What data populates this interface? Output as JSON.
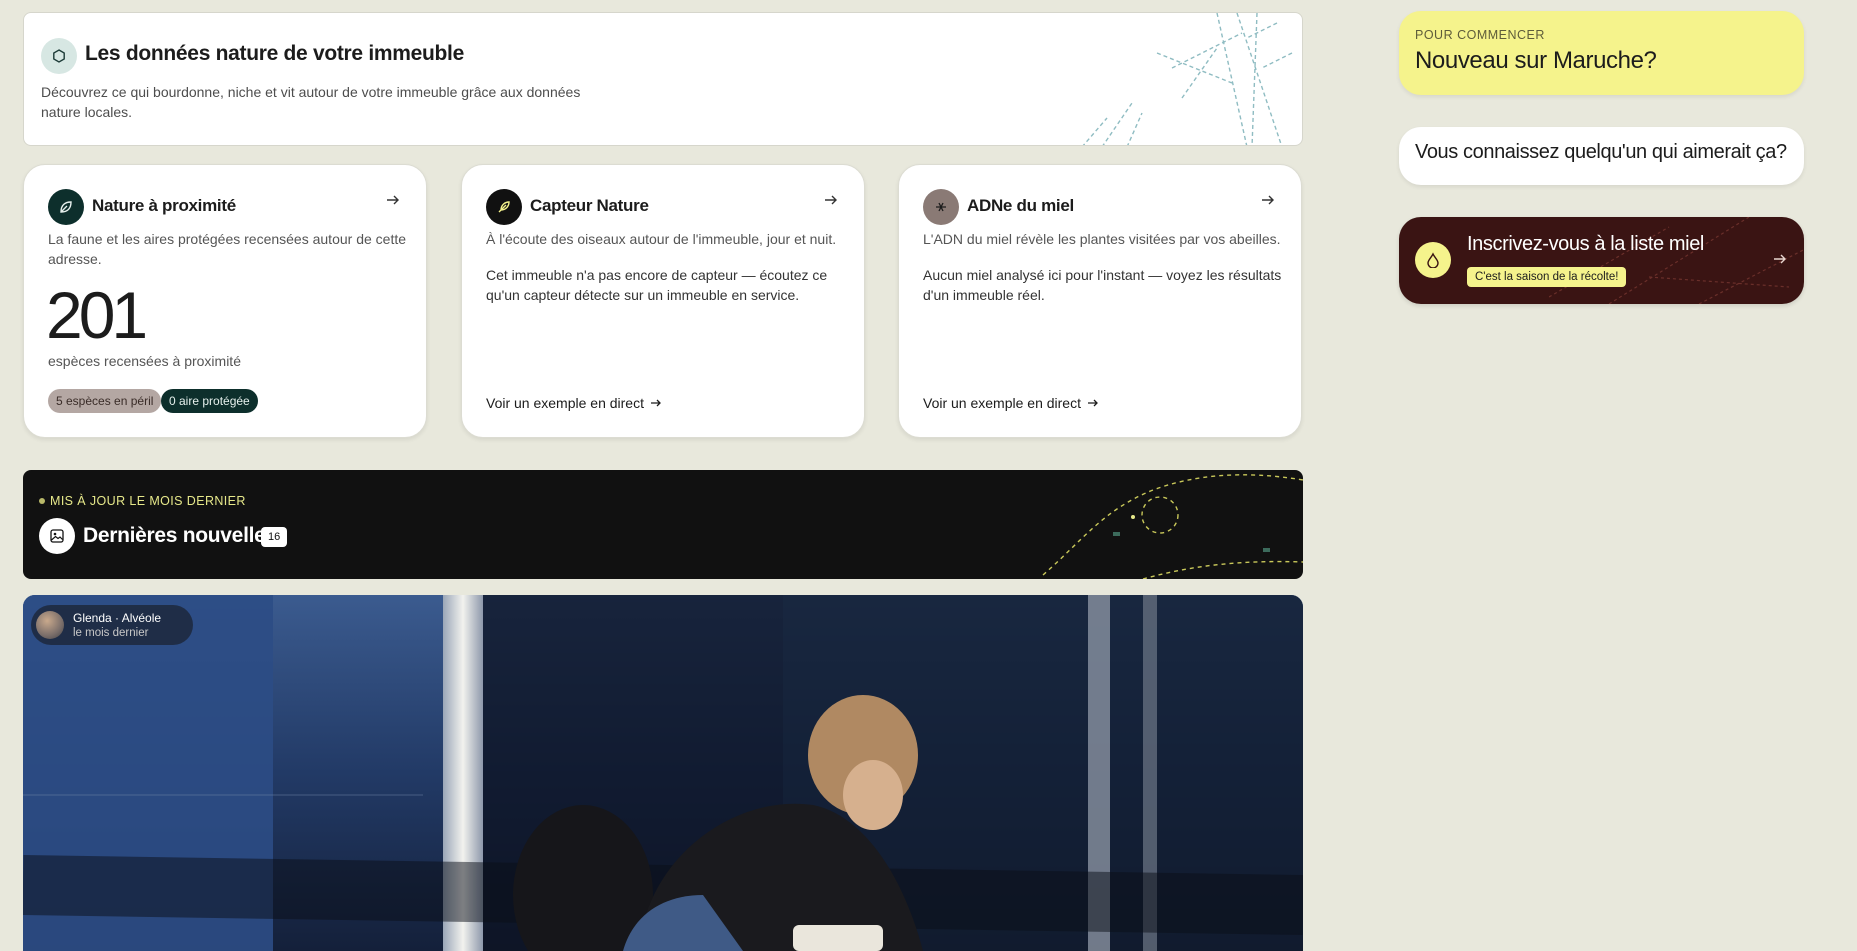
{
  "hero": {
    "icon": "hexagon-icon",
    "title": "Les données nature de votre immeuble",
    "description": "Découvrez ce qui bourdonne, niche et vit autour de votre immeuble grâce aux données nature locales."
  },
  "cards": [
    {
      "icon": "leaf-icon",
      "title": "Nature à proximité",
      "description": "La faune et les aires protégées recensées autour de cette adresse.",
      "count": "201",
      "count_label": "espèces recensées à proximité",
      "badges": [
        "5 espèces en péril",
        "0 aire protégée"
      ]
    },
    {
      "icon": "feather-icon",
      "title": "Capteur Nature",
      "description": "À l'écoute des oiseaux autour de l'immeuble, jour et nuit.",
      "note": "Cet immeuble n'a pas encore de capteur — écoutez ce qu'un capteur détecte sur un immeuble en service.",
      "link": "Voir un exemple en direct"
    },
    {
      "icon": "dna-icon",
      "title": "ADNe du miel",
      "description": "L'ADN du miel révèle les plantes visitées par vos abeilles.",
      "note": "Aucun miel analysé ici pour l'instant — voyez les résultats d'un immeuble réel.",
      "link": "Voir un exemple en direct"
    }
  ],
  "news": {
    "tag": "MIS À JOUR LE MOIS DERNIER",
    "title": "Dernières nouvelles",
    "count": "16",
    "icon": "image-icon"
  },
  "post": {
    "author": "Glenda · Alvéole",
    "time": "le mois dernier"
  },
  "sidebar": {
    "start": {
      "kicker": "POUR COMMENCER",
      "title": "Nouveau sur Maruche?"
    },
    "refer": {
      "title": "Vous connaissez quelqu'un qui aimerait ça?"
    },
    "honey": {
      "title": "Inscrivez-vous à la liste miel",
      "badge": "C'est la saison de la récolte!",
      "icon": "drop-icon"
    }
  },
  "colors": {
    "background": "#e8e8dc",
    "accent_yellow": "#f5f38c",
    "dark_green": "#0d2f2c",
    "honey_dark": "#3a1413"
  }
}
